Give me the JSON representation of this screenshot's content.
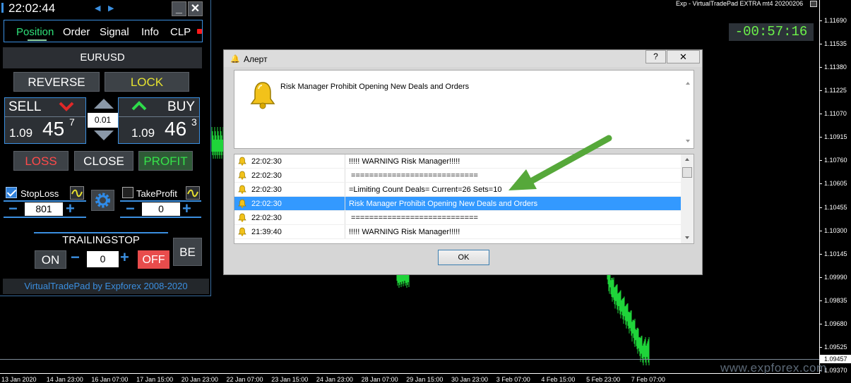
{
  "chart": {
    "title": "Exp - VirtualTradePad EXTRA mt4 20200206",
    "countdown": "-00:57:16",
    "current_price": "1.09457",
    "watermark": "www.expforex.com",
    "price_ticks": [
      "1.11690",
      "1.11535",
      "1.11380",
      "1.11225",
      "1.11070",
      "1.10915",
      "1.10760",
      "1.10605",
      "1.10455",
      "1.10300",
      "1.10145",
      "1.09990",
      "1.09835",
      "1.09680",
      "1.09525",
      "1.09370"
    ],
    "time_ticks": [
      "13 Jan 2020",
      "14 Jan 23:00",
      "16 Jan 07:00",
      "17 Jan 15:00",
      "20 Jan 23:00",
      "22 Jan 07:00",
      "23 Jan 15:00",
      "24 Jan 23:00",
      "28 Jan 07:00",
      "29 Jan 15:00",
      "30 Jan 23:00",
      "3 Feb 07:00",
      "4 Feb 15:00",
      "5 Feb 23:00",
      "7 Feb 07:00"
    ],
    "colors": {
      "bars": "#1fd43a",
      "countdown": "#6cf24a",
      "arrow": "#56a83a"
    }
  },
  "pad": {
    "time": "22:02:44",
    "prev_arrow": "◀",
    "next_arrow": "▶",
    "minimize": "_",
    "close": "✕",
    "tabs": [
      "Position",
      "Order",
      "Signal",
      "Info",
      "CLP"
    ],
    "symbol": "EURUSD",
    "reverse": "REVERSE",
    "lock": "LOCK",
    "sell": {
      "label": "SELL",
      "small": "1.09",
      "big": "45",
      "sup": "7"
    },
    "buy": {
      "label": "BUY",
      "small": "1.09",
      "big": "46",
      "sup": "3"
    },
    "lot": "0.01",
    "loss": "LOSS",
    "close_btn": "CLOSE",
    "profit": "PROFIT",
    "stoploss": {
      "label": "StopLoss",
      "checked": true,
      "value": "801"
    },
    "takeprofit": {
      "label": "TakeProfit",
      "checked": false,
      "value": "0"
    },
    "minus": "−",
    "plus": "+",
    "trailing": {
      "title": "TRAILINGSTOP",
      "on": "ON",
      "value": "0",
      "off": "OFF"
    },
    "be": "BE",
    "footer": "VirtualTradePad by Expforex 2008-2020"
  },
  "alert": {
    "title": "Алерт",
    "help": "?",
    "close": "✕",
    "message": "Risk Manager Prohibit Opening New Deals and Orders",
    "rows": [
      {
        "time": "22:02:30",
        "msg": "!!!!! WARNING Risk Manager!!!!!"
      },
      {
        "time": "22:02:30",
        "msg": " ============================"
      },
      {
        "time": "22:02:30",
        "msg": "=Limiting Count Deals= Current=26 Sets=10"
      },
      {
        "time": "22:02:30",
        "msg": "Risk Manager Prohibit Opening New Deals and Orders"
      },
      {
        "time": "22:02:30",
        "msg": " ============================"
      },
      {
        "time": "21:39:40",
        "msg": "!!!!! WARNING Risk Manager!!!!!"
      }
    ],
    "selected_row": 3,
    "ok": "OK"
  }
}
